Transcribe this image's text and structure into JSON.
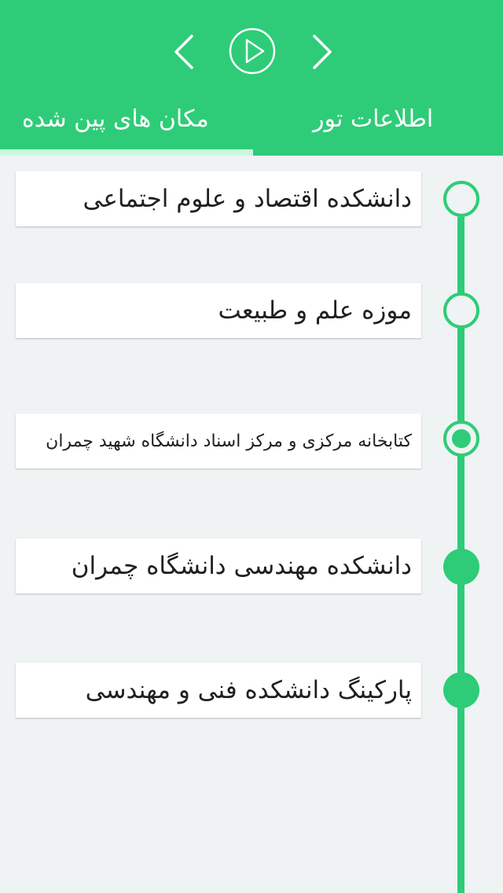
{
  "colors": {
    "accent": "#2ecc78",
    "tab_underline": "#c9f7e0",
    "background": "#eff3f3",
    "card": "#ffffff",
    "text": "#202020"
  },
  "header": {
    "prev_icon": "chevron-left-icon",
    "play_icon": "play-circle-icon",
    "next_icon": "chevron-right-icon",
    "tabs": [
      {
        "label": "مکان های پین شده",
        "active": true
      },
      {
        "label": "اطلاعات تور",
        "active": false
      }
    ]
  },
  "timeline": {
    "items": [
      {
        "label": "دانشکده اقتصاد و علوم اجتماعی",
        "state": "unvisited"
      },
      {
        "label": "موزه علم و طبیعت",
        "state": "unvisited"
      },
      {
        "label": "کتابخانه مرکزی و مرکز اسناد دانشگاه شهید چمران",
        "state": "current"
      },
      {
        "label": "دانشکده مهندسی دانشگاه چمران",
        "state": "visited"
      },
      {
        "label": "پارکینگ دانشکده فنی و مهندسی",
        "state": "visited"
      }
    ]
  }
}
